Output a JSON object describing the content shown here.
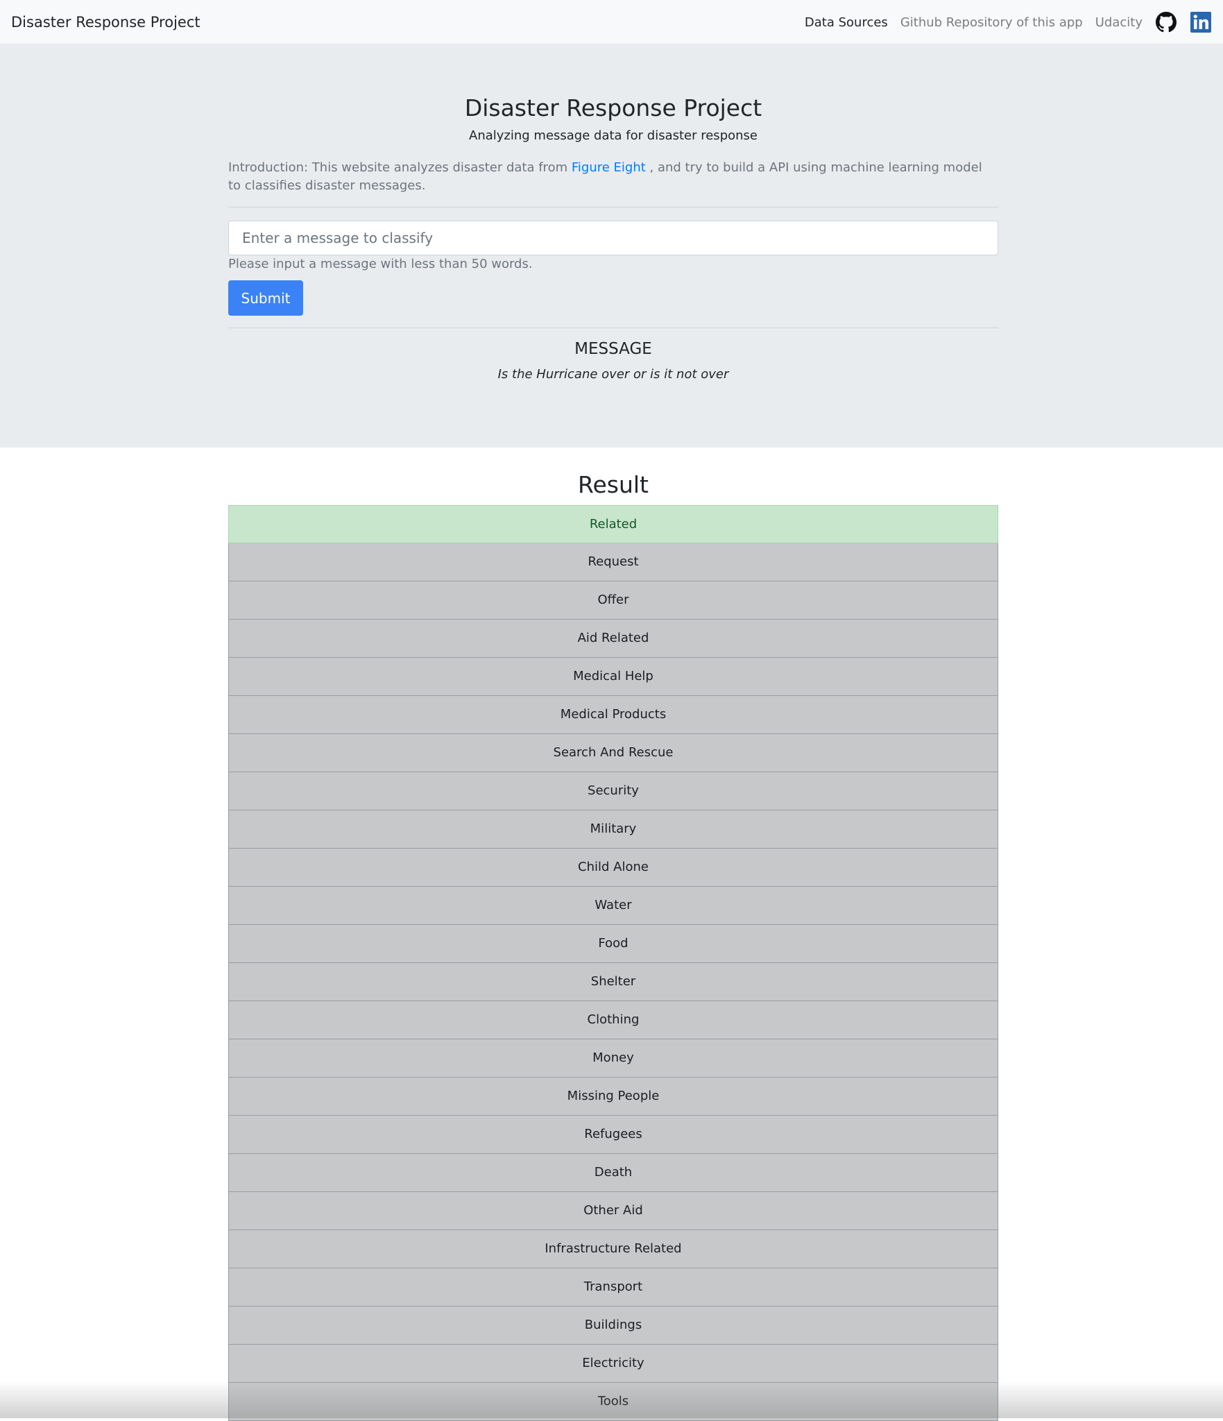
{
  "navbar": {
    "brand": "Disaster Response Project",
    "links": [
      {
        "label": "Data Sources",
        "active": true
      },
      {
        "label": "Github Repository of this app",
        "active": false
      },
      {
        "label": "Udacity",
        "active": false
      }
    ],
    "icons": [
      "github-icon",
      "linkedin-icon"
    ]
  },
  "header": {
    "title": "Disaster Response Project",
    "subtitle": "Analyzing message data for disaster response",
    "intro_before": "Introduction: This website analyzes disaster data from ",
    "intro_link": "Figure Eight",
    "intro_after": " , and try to build a API using machine learning model to classifies disaster messages."
  },
  "form": {
    "placeholder": "Enter a message to classify",
    "value": "",
    "help": "Please input a message with less than 50 words.",
    "submit_label": "Submit"
  },
  "message": {
    "heading": "MESSAGE",
    "text": "Is the Hurricane over or is it not over"
  },
  "result": {
    "title": "Result",
    "categories": [
      {
        "label": "Related",
        "positive": true
      },
      {
        "label": "Request",
        "positive": false
      },
      {
        "label": "Offer",
        "positive": false
      },
      {
        "label": "Aid Related",
        "positive": false
      },
      {
        "label": "Medical Help",
        "positive": false
      },
      {
        "label": "Medical Products",
        "positive": false
      },
      {
        "label": "Search And Rescue",
        "positive": false
      },
      {
        "label": "Security",
        "positive": false
      },
      {
        "label": "Military",
        "positive": false
      },
      {
        "label": "Child Alone",
        "positive": false
      },
      {
        "label": "Water",
        "positive": false
      },
      {
        "label": "Food",
        "positive": false
      },
      {
        "label": "Shelter",
        "positive": false
      },
      {
        "label": "Clothing",
        "positive": false
      },
      {
        "label": "Money",
        "positive": false
      },
      {
        "label": "Missing People",
        "positive": false
      },
      {
        "label": "Refugees",
        "positive": false
      },
      {
        "label": "Death",
        "positive": false
      },
      {
        "label": "Other Aid",
        "positive": false
      },
      {
        "label": "Infrastructure Related",
        "positive": false
      },
      {
        "label": "Transport",
        "positive": false
      },
      {
        "label": "Buildings",
        "positive": false
      },
      {
        "label": "Electricity",
        "positive": false
      },
      {
        "label": "Tools",
        "positive": false
      }
    ]
  },
  "colors": {
    "accent": "#3b82f6",
    "link": "#007bff",
    "positive_bg": "#c8e6cb",
    "negative_bg": "#c6c8ca",
    "jumbotron_bg": "#e9ecef",
    "linkedin": "#2867b2"
  }
}
